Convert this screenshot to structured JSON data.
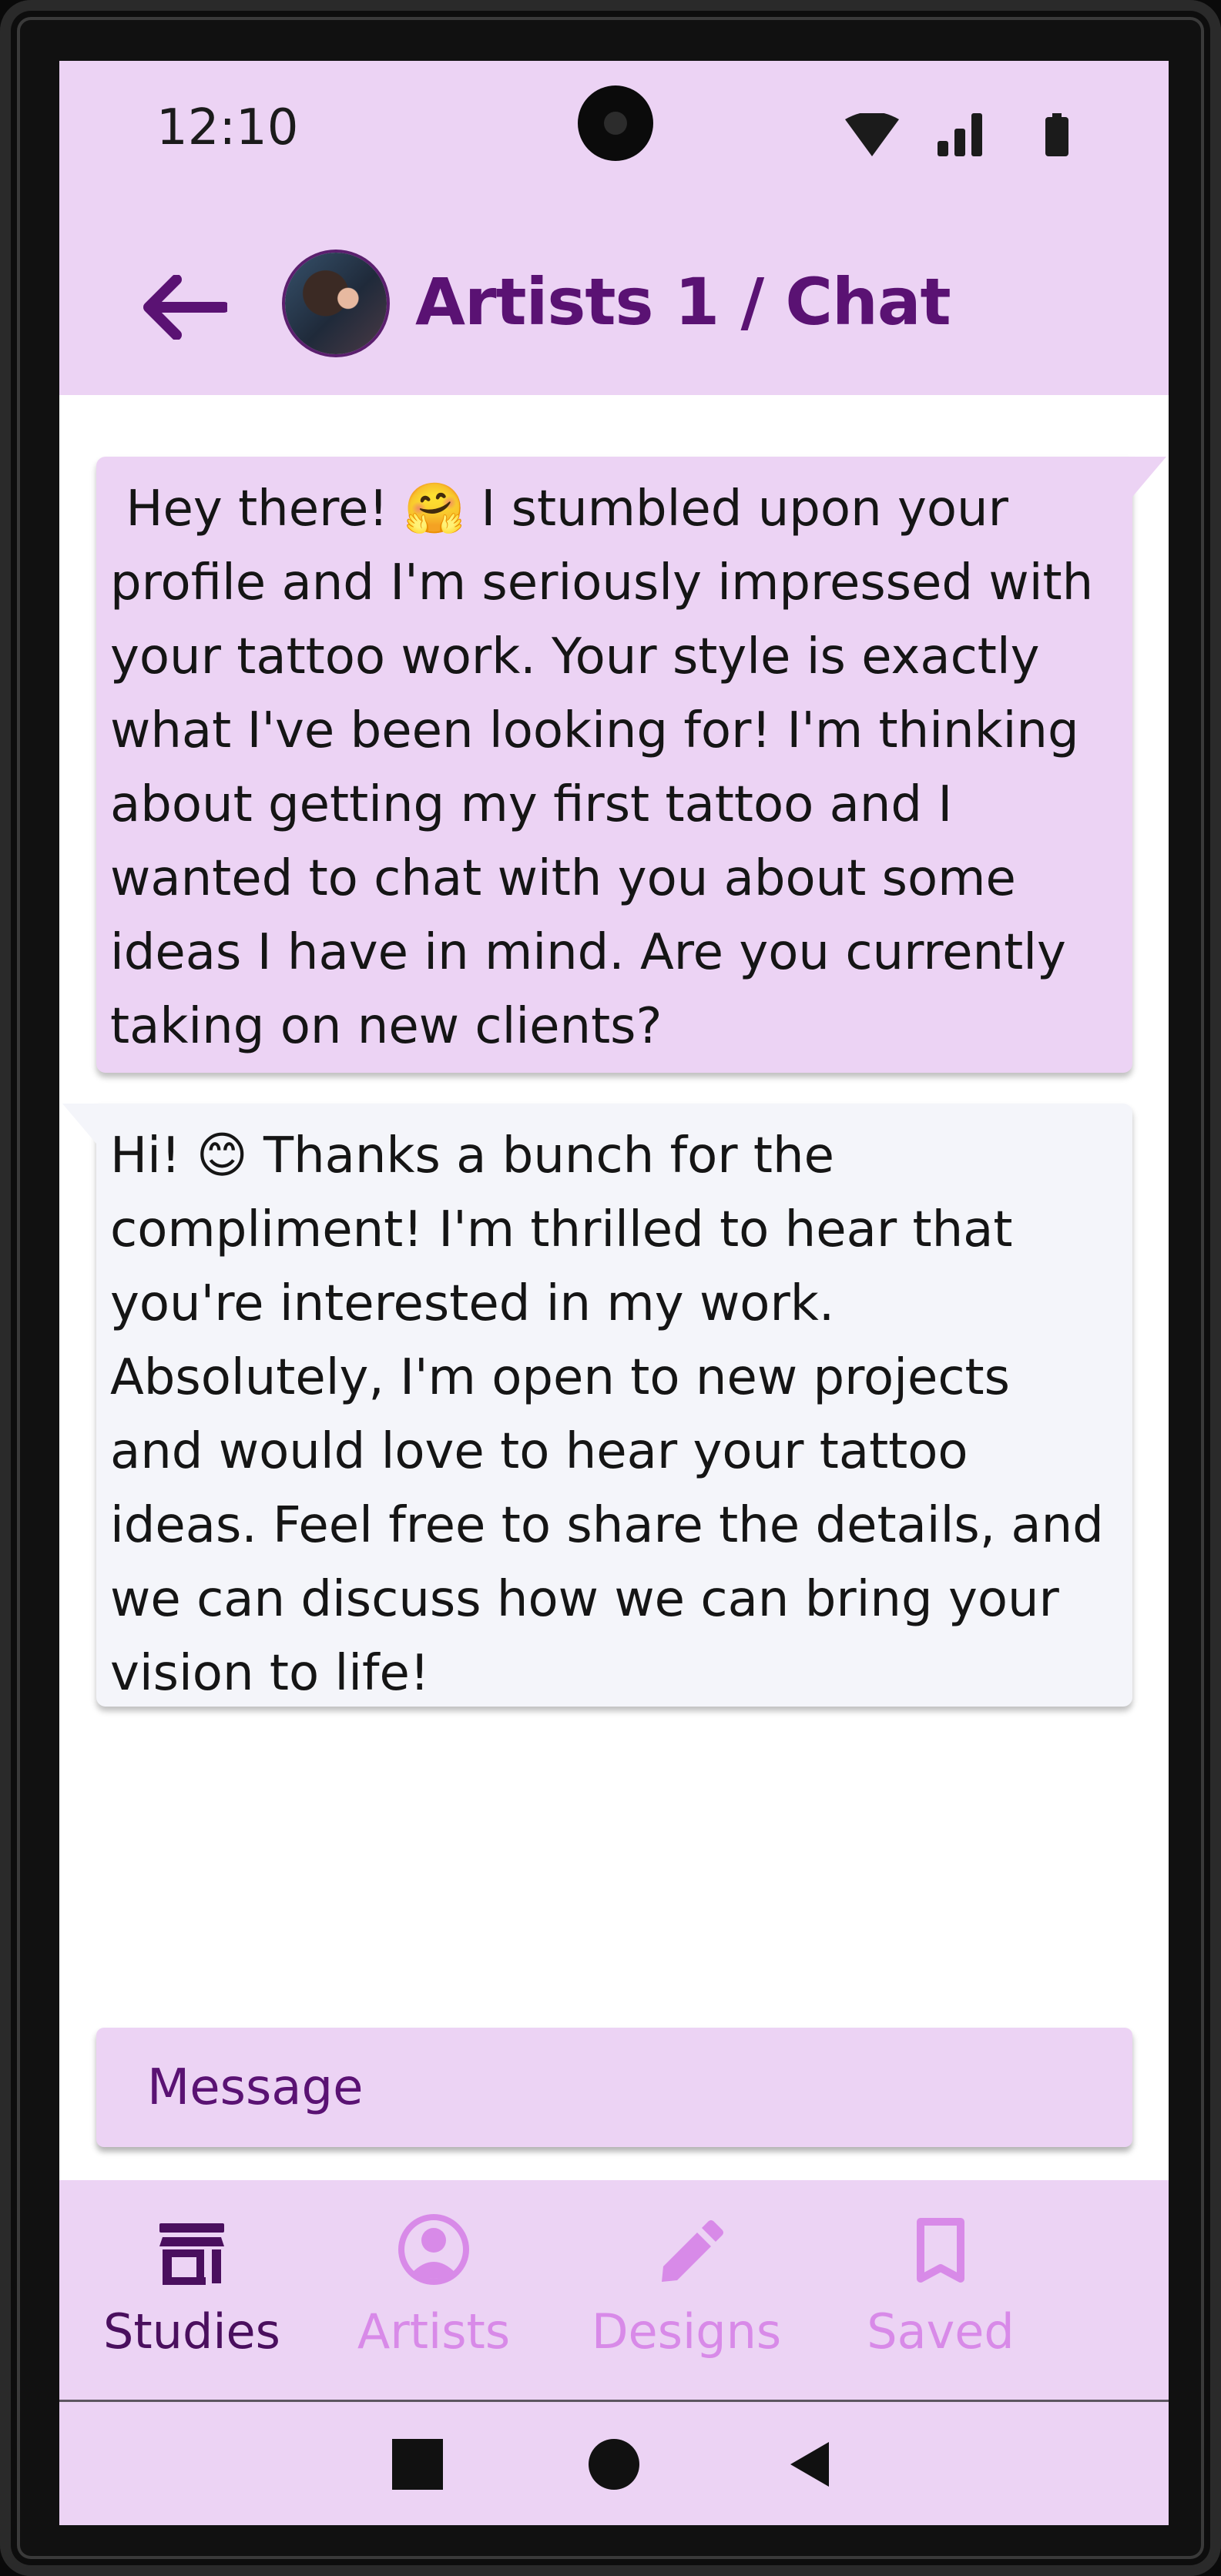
{
  "status_bar": {
    "time": "12:10",
    "icons": [
      "wifi-icon",
      "signal-icon",
      "battery-icon"
    ]
  },
  "app_bar": {
    "back_icon": "arrow-left-icon",
    "title": "Artists 1 / Chat"
  },
  "messages": [
    {
      "sender": "me",
      "text": " Hey there! 🤗 I stumbled upon your profile and I'm seriously impressed with your tattoo work. Your style is exactly what I've been looking for! I'm thinking about getting my first tattoo and I wanted to chat with you about some ideas I have in mind. Are you currently taking on new clients?"
    },
    {
      "sender": "artist",
      "text": "Hi! 😊 Thanks a bunch for the compliment! I'm thrilled to hear that you're interested in my work. Absolutely, I'm open to new projects and would love to hear your tattoo ideas. Feel free to share the details, and we can discuss how we can bring your vision to life!"
    }
  ],
  "composer": {
    "placeholder": "Message"
  },
  "bottom_nav": {
    "items": [
      {
        "label": "Studies",
        "icon": "store-icon",
        "active": true
      },
      {
        "label": "Artists",
        "icon": "account-circle-icon",
        "active": false
      },
      {
        "label": "Designs",
        "icon": "pencil-icon",
        "active": false
      },
      {
        "label": "Saved",
        "icon": "bookmark-icon",
        "active": false
      }
    ]
  },
  "system_nav": {
    "icons": [
      "recents-square-icon",
      "home-circle-icon",
      "back-triangle-icon"
    ]
  },
  "colors": {
    "header_bg": "#ecd3f4",
    "title": "#5a1273",
    "nav_active": "#4a0f5e",
    "nav_inactive": "#d88ae8",
    "received_bubble": "#f4f5fa"
  }
}
